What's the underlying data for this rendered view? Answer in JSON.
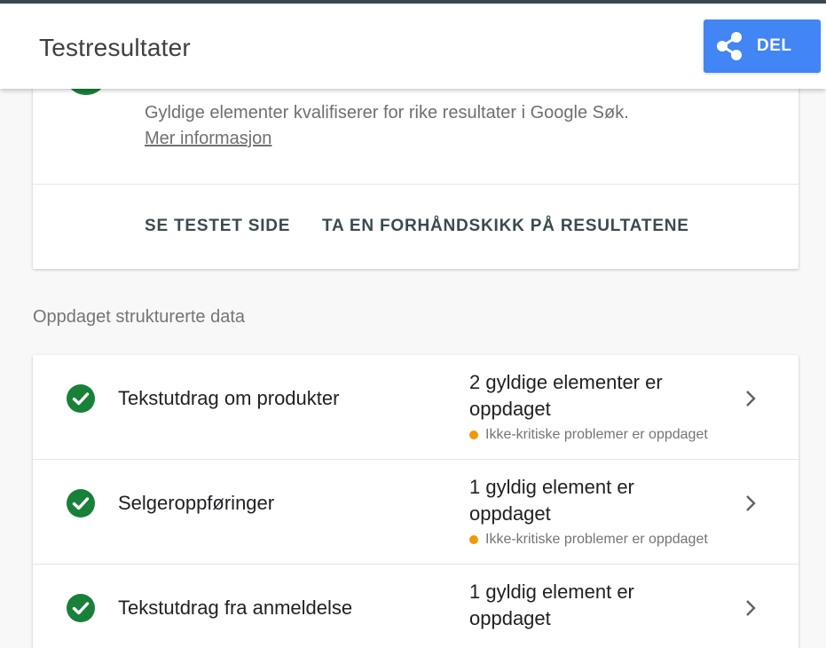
{
  "header": {
    "title": "Testresultater",
    "share_label": "DEL"
  },
  "result_card": {
    "description": "Gyldige elementer kvalifiserer for rike resultater i Google Søk.",
    "more_info_label": "Mer informasjon",
    "view_tested_page_label": "SE TESTET SIDE",
    "preview_results_label": "TA EN FORHÅNDSKIKK PÅ RESULTATENE"
  },
  "structured_data": {
    "heading": "Oppdaget strukturerte data",
    "items": [
      {
        "name": "Tekstutdrag om produkter",
        "count_text": "2 gyldige elementer er oppdaget",
        "warning": "Ikke-kritiske problemer er oppdaget"
      },
      {
        "name": "Selgeroppføringer",
        "count_text": "1 gyldig element er oppdaget",
        "warning": "Ikke-kritiske problemer er oppdaget"
      },
      {
        "name": "Tekstutdrag fra anmeldelse",
        "count_text": "1 gyldig element er oppdaget",
        "warning": ""
      }
    ]
  },
  "colors": {
    "brand_blue": "#4285f4",
    "success_green": "#188038",
    "warning_orange": "#f29900"
  },
  "icons": {
    "share": "share-icon",
    "check": "check-circle-icon",
    "chevron": "chevron-right-icon"
  }
}
